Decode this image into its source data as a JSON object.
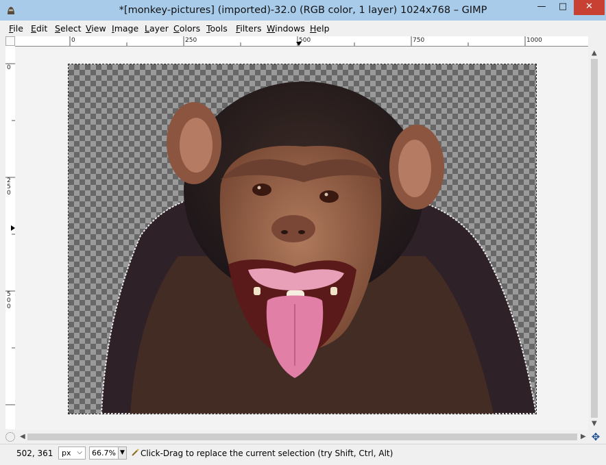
{
  "window": {
    "title": "*[monkey-pictures] (imported)-32.0 (RGB color, 1 layer) 1024x768 – GIMP",
    "app_icon": "gimp-wilber-icon",
    "controls": {
      "minimize": "—",
      "maximize": "□",
      "close": "✕"
    }
  },
  "menu": [
    {
      "label": "File",
      "key": "F",
      "rest": "ile"
    },
    {
      "label": "Edit",
      "key": "E",
      "rest": "dit"
    },
    {
      "label": "Select",
      "key": "S",
      "rest": "elect"
    },
    {
      "label": "View",
      "key": "V",
      "rest": "iew"
    },
    {
      "label": "Image",
      "key": "I",
      "rest": "mage"
    },
    {
      "label": "Layer",
      "key": "L",
      "rest": "ayer"
    },
    {
      "label": "Colors",
      "key": "C",
      "rest": "olors"
    },
    {
      "label": "Tools",
      "key": "T",
      "rest": "ools"
    },
    {
      "label": "Filters",
      "key": "F",
      "rest": "ilters"
    },
    {
      "label": "Windows",
      "key": "W",
      "rest": "indows"
    },
    {
      "label": "Help",
      "key": "H",
      "rest": "elp"
    }
  ],
  "rulers": {
    "horizontal": [
      "0",
      "250",
      "500",
      "750",
      "1000"
    ],
    "vertical": [
      "0",
      "250",
      "500"
    ]
  },
  "canvas": {
    "subject": "chimpanzee-photo",
    "background": "transparency-checkerboard",
    "selection": "dashed-marching-ants"
  },
  "statusbar": {
    "coords": "502, 361",
    "unit": "px",
    "zoom": "66.7%",
    "message": "Click-Drag to replace the current selection (try Shift, Ctrl, Alt)"
  },
  "colors": {
    "titlebar": "#a8cbea",
    "close_button": "#c84031",
    "checker_dark": "#676767",
    "checker_light": "#9a9a9a"
  }
}
